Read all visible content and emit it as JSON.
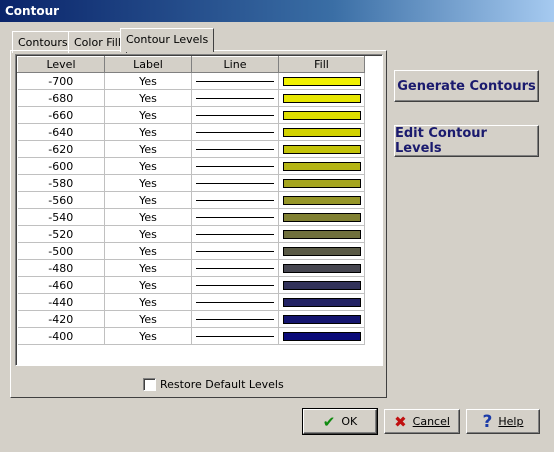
{
  "window": {
    "title": "Contour"
  },
  "tabs": [
    {
      "label": "Contours"
    },
    {
      "label": "Color Fill"
    },
    {
      "label": "Contour Levels"
    }
  ],
  "table": {
    "columns": [
      "Level",
      "Label",
      "Line",
      "Fill"
    ],
    "rows": [
      {
        "level": "-700",
        "label": "Yes",
        "fill": "#f0f000"
      },
      {
        "level": "-680",
        "label": "Yes",
        "fill": "#e6e600"
      },
      {
        "level": "-660",
        "label": "Yes",
        "fill": "#dcdc00"
      },
      {
        "level": "-640",
        "label": "Yes",
        "fill": "#d2d200"
      },
      {
        "level": "-620",
        "label": "Yes",
        "fill": "#c3c30a"
      },
      {
        "level": "-600",
        "label": "Yes",
        "fill": "#b4b414"
      },
      {
        "level": "-580",
        "label": "Yes",
        "fill": "#a5a51e"
      },
      {
        "level": "-560",
        "label": "Yes",
        "fill": "#969628"
      },
      {
        "level": "-540",
        "label": "Yes",
        "fill": "#808032"
      },
      {
        "level": "-520",
        "label": "Yes",
        "fill": "#70703c"
      },
      {
        "level": "-500",
        "label": "Yes",
        "fill": "#5a5a46"
      },
      {
        "level": "-480",
        "label": "Yes",
        "fill": "#464650"
      },
      {
        "level": "-460",
        "label": "Yes",
        "fill": "#32325a"
      },
      {
        "level": "-440",
        "label": "Yes",
        "fill": "#232364"
      },
      {
        "level": "-420",
        "label": "Yes",
        "fill": "#14146e"
      },
      {
        "level": "-400",
        "label": "Yes",
        "fill": "#0a0a78"
      }
    ]
  },
  "restore_default": {
    "label": "Restore Default Levels",
    "checked": false
  },
  "buttons": {
    "generate": "Generate Contours",
    "edit": "Edit Contour Levels",
    "ok": "OK",
    "cancel": "Cancel",
    "help": "Help"
  },
  "icons": {
    "ok": "checkmark-icon",
    "cancel": "x-icon",
    "help": "question-mark-icon"
  }
}
